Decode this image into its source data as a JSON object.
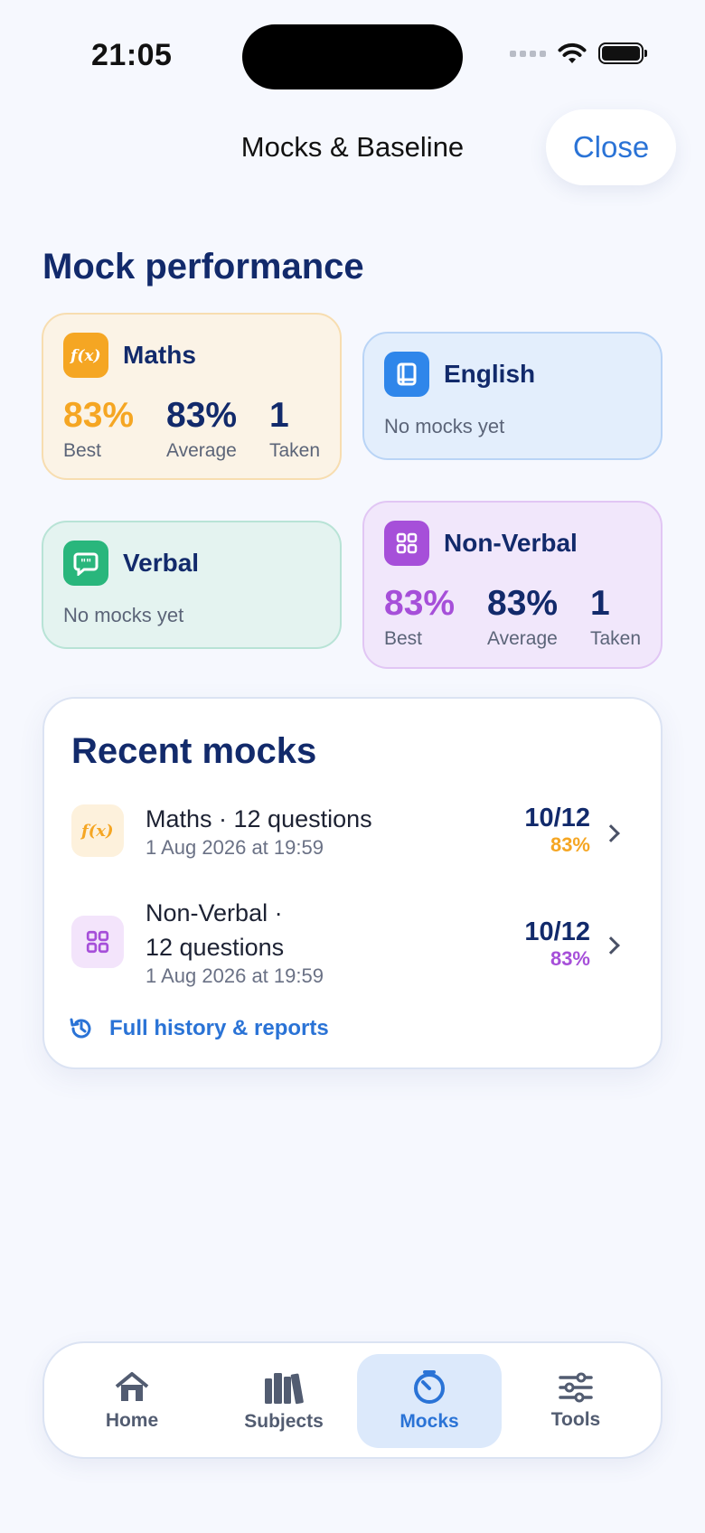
{
  "status_bar": {
    "time": "21:05"
  },
  "header": {
    "title": "Mocks & Baseline",
    "close_label": "Close"
  },
  "section": {
    "title": "Mock performance"
  },
  "subjects": {
    "maths": {
      "name": "Maths",
      "color": "#f5a623",
      "best": "83%",
      "average": "83%",
      "taken": "1",
      "best_label": "Best",
      "average_label": "Average",
      "taken_label": "Taken",
      "icon": "function-icon"
    },
    "english": {
      "name": "English",
      "color": "#2f86ea",
      "empty_text": "No mocks yet",
      "icon": "book-icon"
    },
    "verbal": {
      "name": "Verbal",
      "color": "#29b67c",
      "empty_text": "No mocks yet",
      "icon": "speech-bubble-icon"
    },
    "nonverbal": {
      "name": "Non-Verbal",
      "color": "#a64fd9",
      "best": "83%",
      "average": "83%",
      "taken": "1",
      "best_label": "Best",
      "average_label": "Average",
      "taken_label": "Taken",
      "icon": "grid-icon"
    }
  },
  "recent": {
    "title": "Recent mocks",
    "items": [
      {
        "title": "Maths · 12 questions",
        "date": "1 Aug 2026 at 19:59",
        "score": "10/12",
        "percent": "83%",
        "color": "#f5a623"
      },
      {
        "title_line1": "Non-Verbal ·",
        "title_line2": "12 questions",
        "date": "1 Aug 2026 at 19:59",
        "score": "10/12",
        "percent": "83%",
        "color": "#a64fd9"
      }
    ],
    "history_link": "Full history & reports"
  },
  "tabbar": {
    "tabs": [
      {
        "label": "Home",
        "icon": "house-icon"
      },
      {
        "label": "Subjects",
        "icon": "books-icon"
      },
      {
        "label": "Mocks",
        "icon": "stopwatch-icon",
        "active": true
      },
      {
        "label": "Tools",
        "icon": "sliders-icon"
      }
    ]
  }
}
